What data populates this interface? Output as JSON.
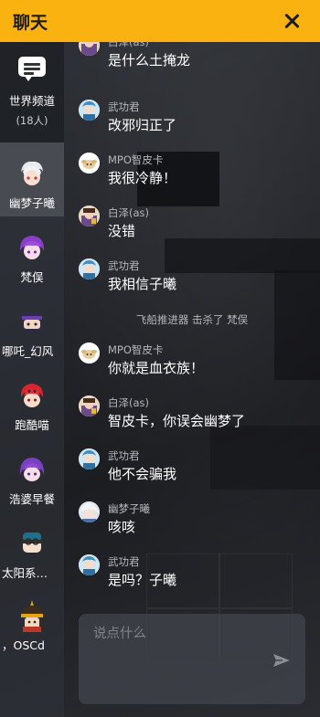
{
  "header": {
    "title": "聊天",
    "close_icon": "close-icon"
  },
  "sidebar": {
    "world": {
      "label": "世界频道",
      "count": "(18人)",
      "icon": "chat-bubble-icon"
    },
    "users": [
      {
        "name": "幽梦子曦",
        "active": true
      },
      {
        "name": "梵俣",
        "active": false
      },
      {
        "name": "哪吒_幻风",
        "active": false
      },
      {
        "name": "跑酷喵",
        "active": false
      },
      {
        "name": "浩婆早餐",
        "active": false
      },
      {
        "name": "太阳系…",
        "active": false
      },
      {
        "name": "，OSCd",
        "active": false
      }
    ]
  },
  "messages": [
    {
      "sender": "白泽(as)",
      "text": "是什么土掩龙"
    },
    {
      "sender": "武功君",
      "text": "改邪归正了"
    },
    {
      "sender": "MPO智皮卡",
      "text": "我很冷静！"
    },
    {
      "sender": "白泽(as)",
      "text": "没错"
    },
    {
      "sender": "武功君",
      "text": "我相信子曦"
    },
    {
      "system": "飞船推进器 击杀了 梵俣"
    },
    {
      "sender": "MPO智皮卡",
      "text": "你就是血衣族！"
    },
    {
      "sender": "白泽(as)",
      "text": "智皮卡，你误会幽梦了"
    },
    {
      "sender": "武功君",
      "text": "他不会骗我"
    },
    {
      "sender": "幽梦子曦",
      "text": "咳咳"
    },
    {
      "sender": "武功君",
      "text": "是吗？子曦"
    }
  ],
  "input": {
    "placeholder": "说点什么",
    "send_icon": "send-icon"
  },
  "colors": {
    "accent": "#f9b210",
    "background": "#1b1d22",
    "text": "#ffffff",
    "muted": "#b4b7bd"
  }
}
